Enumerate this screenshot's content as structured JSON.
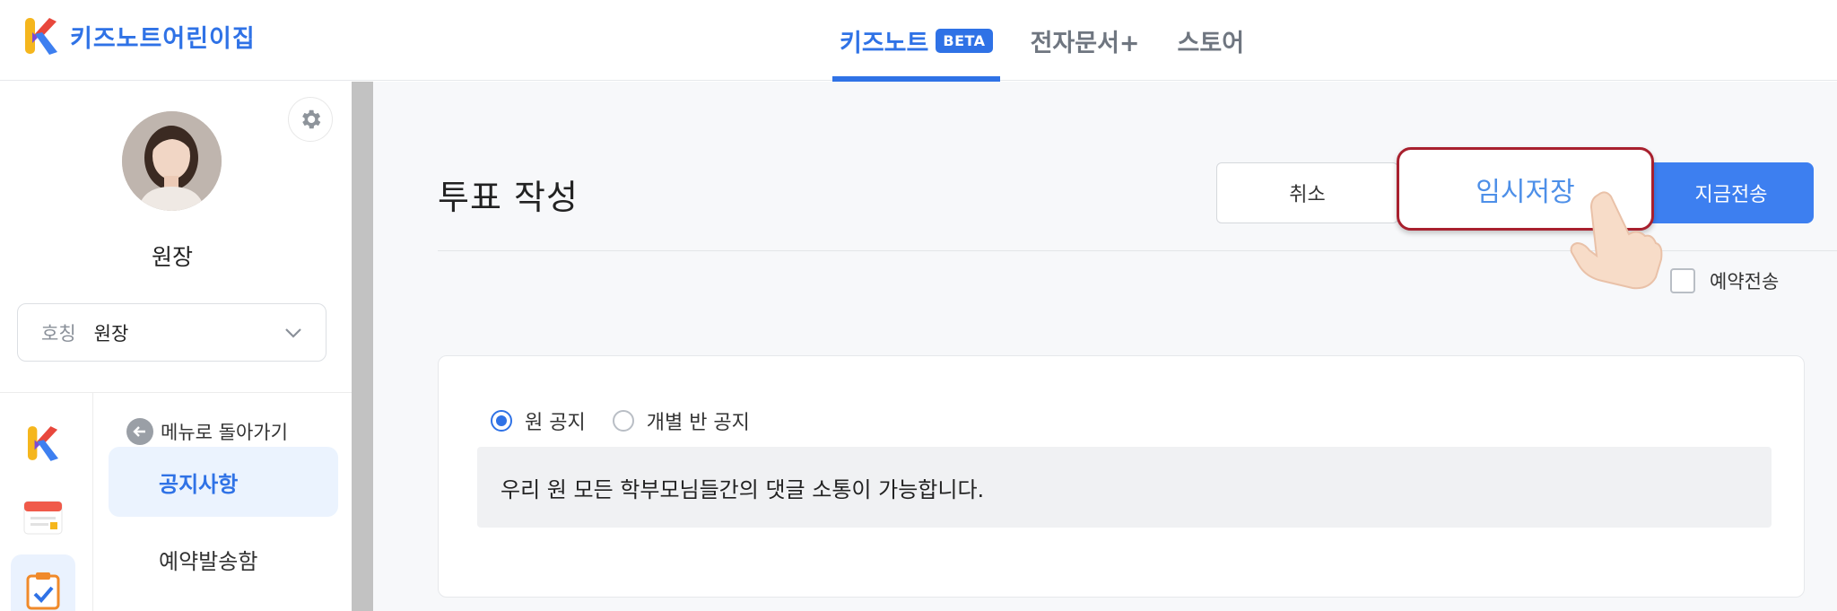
{
  "brand": {
    "name": "키즈노트어린이집"
  },
  "nav": {
    "tabs": [
      {
        "label": "키즈노트",
        "badge": "BETA",
        "active": true
      },
      {
        "label": "전자문서+"
      },
      {
        "label": "스토어"
      }
    ]
  },
  "sidebar": {
    "profile_name": "원장",
    "title_select": {
      "label": "호칭",
      "value": "원장"
    },
    "back_label": "메뉴로 돌아가기",
    "menu_items": [
      {
        "label": "공지사항",
        "active": true
      },
      {
        "label": "예약발송함"
      }
    ]
  },
  "main": {
    "page_title": "투표 작성",
    "buttons": {
      "cancel": "취소",
      "draft": "임시저장",
      "send_now": "지금전송"
    },
    "reserve_label": "예약전송",
    "radio_options": [
      {
        "label": "원 공지",
        "checked": true
      },
      {
        "label": "개별 반 공지",
        "checked": false
      }
    ],
    "notice_text": "우리 원 모든 학부모님들간의 댓글 소통이 가능합니다."
  },
  "colors": {
    "accent": "#2f72e6",
    "send_button": "#3d7ff0",
    "highlight_border": "#a8202e"
  }
}
